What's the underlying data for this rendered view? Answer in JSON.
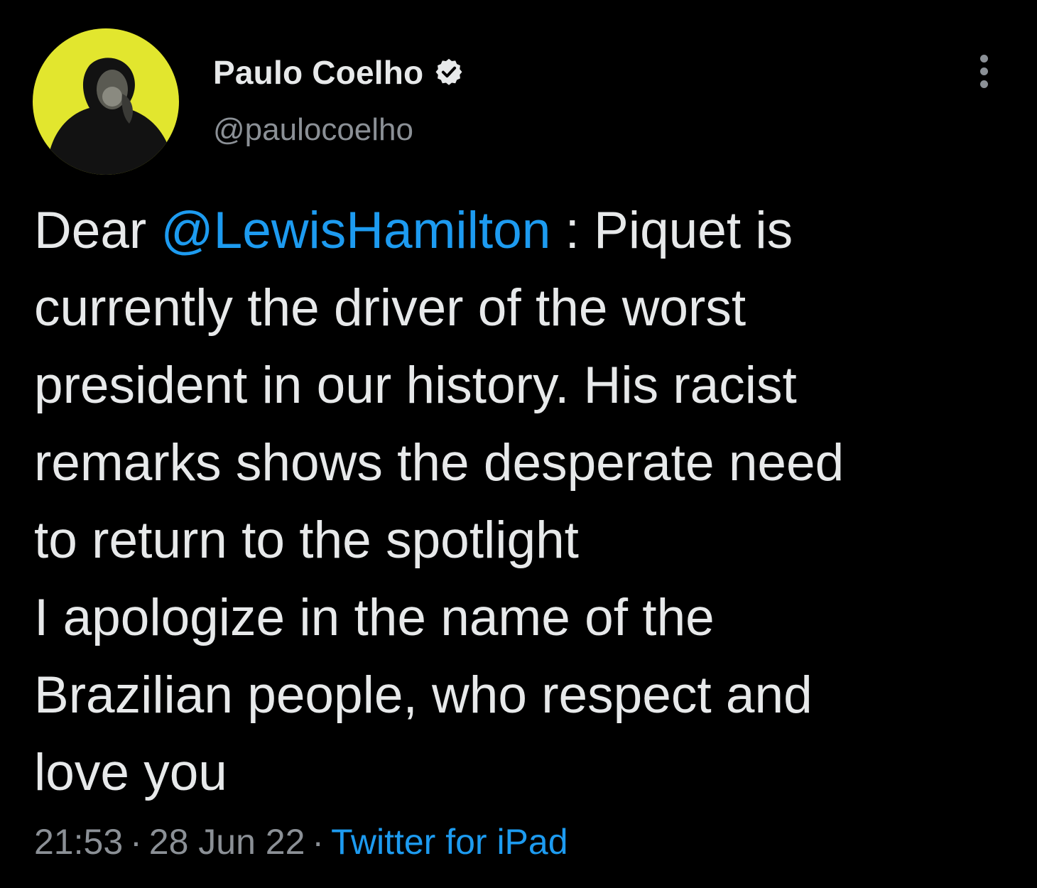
{
  "tweet": {
    "author": {
      "name": "Paulo Coelho",
      "handle": "@paulocoelho",
      "verified": true,
      "avatar_icon": "portrait-avatar"
    },
    "menu_icon": "more-vertical-icon",
    "text": {
      "prefix": "Dear ",
      "mention": "@LewisHamilton",
      "line1_rest": " : Piquet is",
      "line2": "currently the driver of the worst",
      "line3": "president in our history. His racist",
      "line4": "remarks shows the desperate need",
      "line5": "to return to the spotlight",
      "line6": "I apologize in the name of the",
      "line7": "Brazilian people, who respect and",
      "line8": "love you"
    },
    "meta": {
      "time": "21:53",
      "separator": "·",
      "date": "28 Jun 22",
      "source": "Twitter for iPad"
    }
  },
  "colors": {
    "background": "#000000",
    "text": "#e7e9ea",
    "muted": "#8b9096",
    "link": "#1d9bf0",
    "avatar_bg": "#e2e62e"
  }
}
